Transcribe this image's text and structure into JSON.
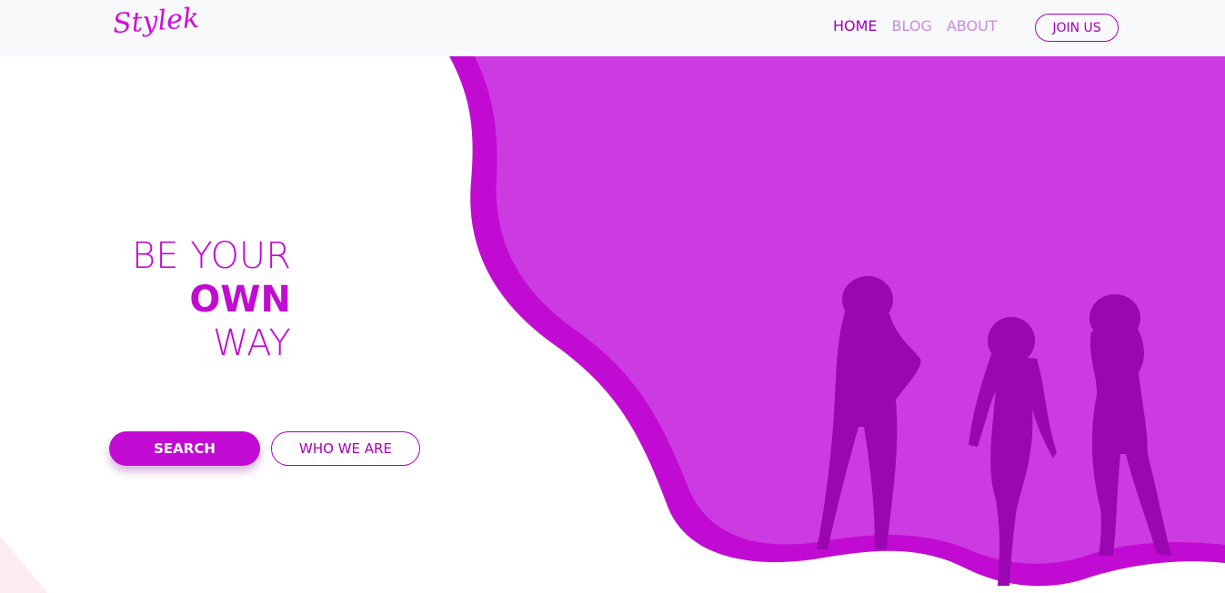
{
  "brand": {
    "logo_text": "Stylek"
  },
  "nav": {
    "items": [
      {
        "label": "HOME",
        "active": true
      },
      {
        "label": "BLOG",
        "active": false
      },
      {
        "label": "ABOUT",
        "active": false
      }
    ],
    "join_label": "JOIN US"
  },
  "hero": {
    "headline_line1": "BE YOUR",
    "headline_line2": "OWN",
    "headline_line3": "WAY",
    "search_label": "SEARCH",
    "who_label": "WHO WE ARE"
  },
  "colors": {
    "accent": "#c20bd2",
    "accent_dark": "#a500b9",
    "panel": "#cc3be2",
    "silhouette": "#9a06b0",
    "nav_inactive": "#c98be3"
  }
}
